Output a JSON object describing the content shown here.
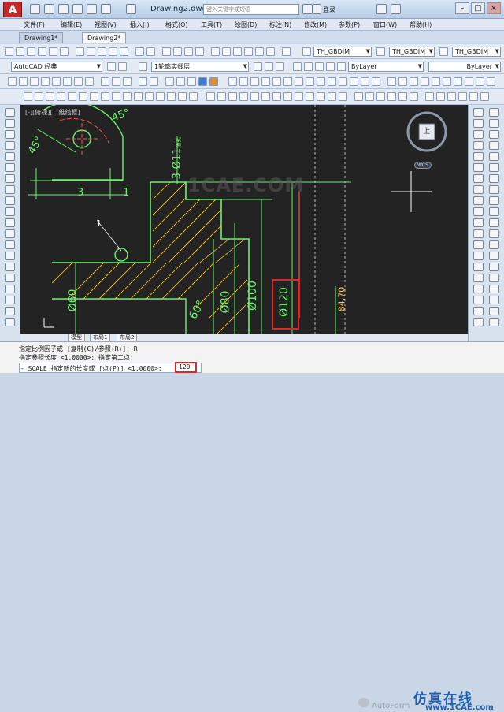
{
  "titlebar": {
    "doc_title": "Drawing2.dwg",
    "search_placeholder": "键入关键字或短语",
    "login": "登录",
    "app_letter": "A"
  },
  "menu": [
    "文件(F)",
    "编辑(E)",
    "视图(V)",
    "插入(I)",
    "格式(O)",
    "工具(T)",
    "绘图(D)",
    "标注(N)",
    "修改(M)",
    "参数(P)",
    "窗口(W)",
    "帮助(H)"
  ],
  "tabs": [
    "Drawing1*",
    "Drawing2*"
  ],
  "toolbar": {
    "workspace": "AutoCAD 经典",
    "style1": "TH_GBDIM",
    "style2": "TH_GBDIM",
    "layer": "1轮廓实线层",
    "color": "ByLayer",
    "linetype": "ByLayer"
  },
  "canvas": {
    "view_label": "[-][俯视][二维线框]",
    "watermark": "1CAE.COM",
    "wcs": "WCS",
    "compass_top": "上",
    "labels": {
      "angle45_top": "45°",
      "angle45_left": "45°",
      "dim_3": "3",
      "dim_1": "1",
      "thread": "3-Ø11",
      "thread_suffix": "通孔",
      "leader_1": "1",
      "d60": "Ø60",
      "d80": "Ø80",
      "angle60": "60°",
      "d100": "Ø100",
      "d120": "Ø120",
      "d84": "84.70"
    }
  },
  "layout_tabs": [
    "模型",
    "布局1",
    "布局2"
  ],
  "command": {
    "line1": "指定比例因子或 [复制(C)/参照(R)]: R",
    "line2": "指定参照长度 <1.0000>:  指定第二点:",
    "prompt": "- SCALE 指定新的长度或 [点(P)] <1.0000>:",
    "value": "120"
  },
  "brand": {
    "name": "仿真在线",
    "url": "www.1CAE.com",
    "account": "AutoForm"
  },
  "colors": {
    "canvas_bg": "#232323",
    "dim_green": "#6cf26c",
    "highlight_red": "#e02626",
    "brand_blue": "#1d5fb0"
  }
}
